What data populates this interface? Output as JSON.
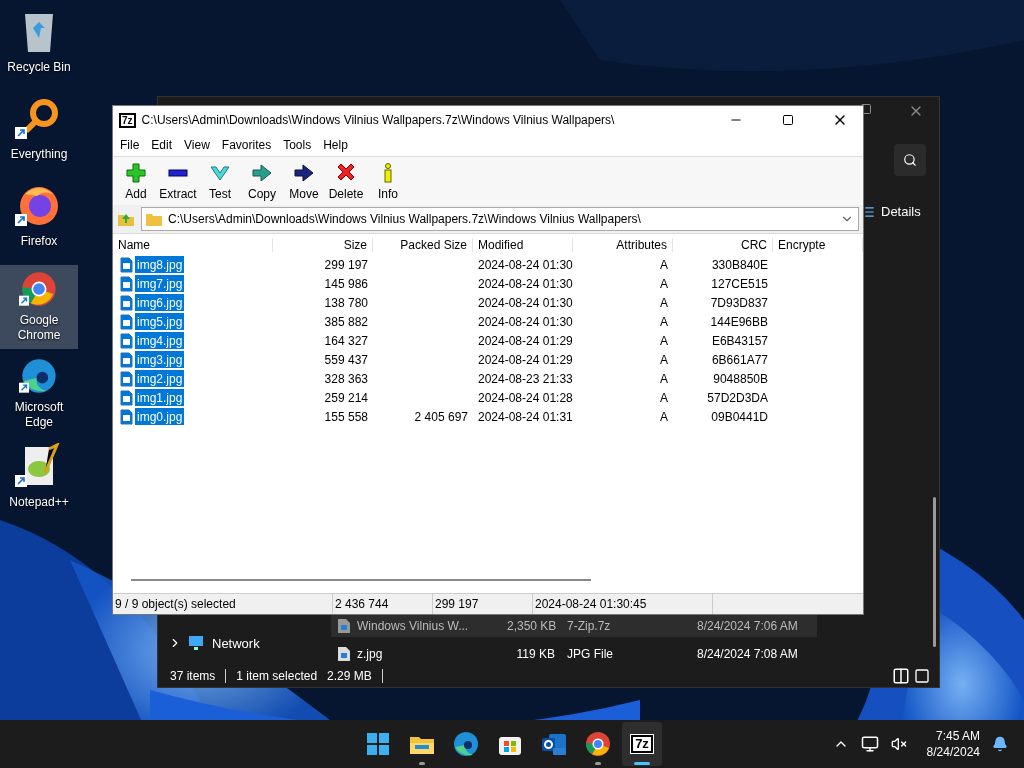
{
  "desktop_icons": [
    {
      "label": "Recycle Bin",
      "selected": false
    },
    {
      "label": "Everything",
      "selected": false
    },
    {
      "label": "Firefox",
      "selected": false
    },
    {
      "label": "Google Chrome",
      "selected": true
    },
    {
      "label": "Microsoft Edge",
      "selected": false
    },
    {
      "label": "Notepad++",
      "selected": false
    }
  ],
  "explorer": {
    "details": "Details",
    "nav": [
      {
        "label": "Network",
        "expanded": false
      }
    ],
    "files": [
      {
        "name": "Windows Vilnius W...",
        "size": "2,350 KB",
        "type": "7-Zip.7z",
        "date": "8/24/2024 7:06 AM",
        "selected": true
      },
      {
        "name": "z.jpg",
        "size": "119 KB",
        "type": "JPG File",
        "date": "8/24/2024 7:08 AM",
        "selected": false
      }
    ],
    "status": [
      "37 items",
      "1 item selected",
      "2.29 MB"
    ]
  },
  "window": {
    "logo": "7z",
    "title": "C:\\Users\\Admin\\Downloads\\Windows Vilnius Wallpapers.7z\\Windows Vilnius Wallpapers\\",
    "menu": [
      "File",
      "Edit",
      "View",
      "Favorites",
      "Tools",
      "Help"
    ],
    "toolbar": [
      "Add",
      "Extract",
      "Test",
      "Copy",
      "Move",
      "Delete",
      "Info"
    ],
    "address": "C:\\Users\\Admin\\Downloads\\Windows Vilnius Wallpapers.7z\\Windows Vilnius Wallpapers\\",
    "columns": [
      "Name",
      "Size",
      "Packed Size",
      "Modified",
      "Attributes",
      "CRC",
      "Encrypte"
    ],
    "rows": [
      {
        "name": "img8.jpg",
        "size": "299 197",
        "packed": "",
        "modified": "2024-08-24 01:30",
        "attributes": "A",
        "crc": "330B840E",
        "selected": true
      },
      {
        "name": "img7.jpg",
        "size": "145 986",
        "packed": "",
        "modified": "2024-08-24 01:30",
        "attributes": "A",
        "crc": "127CE515",
        "selected": true
      },
      {
        "name": "img6.jpg",
        "size": "138 780",
        "packed": "",
        "modified": "2024-08-24 01:30",
        "attributes": "A",
        "crc": "7D93D837",
        "selected": true
      },
      {
        "name": "img5.jpg",
        "size": "385 882",
        "packed": "",
        "modified": "2024-08-24 01:30",
        "attributes": "A",
        "crc": "144E96BB",
        "selected": true
      },
      {
        "name": "img4.jpg",
        "size": "164 327",
        "packed": "",
        "modified": "2024-08-24 01:29",
        "attributes": "A",
        "crc": "E6B43157",
        "selected": true
      },
      {
        "name": "img3.jpg",
        "size": "559 437",
        "packed": "",
        "modified": "2024-08-24 01:29",
        "attributes": "A",
        "crc": "6B661A77",
        "selected": true
      },
      {
        "name": "img2.jpg",
        "size": "328 363",
        "packed": "",
        "modified": "2024-08-23 21:33",
        "attributes": "A",
        "crc": "9048850B",
        "selected": true
      },
      {
        "name": "img1.jpg",
        "size": "259 214",
        "packed": "",
        "modified": "2024-08-24 01:28",
        "attributes": "A",
        "crc": "57D2D3DA",
        "selected": true
      },
      {
        "name": "img0.jpg",
        "size": "155 558",
        "packed": "2 405 697",
        "modified": "2024-08-24 01:31",
        "attributes": "A",
        "crc": "09B0441D",
        "selected": true
      }
    ],
    "status": [
      "9 / 9 object(s) selected",
      "2 436 744",
      "299 197",
      "2024-08-24 01:30:45"
    ]
  },
  "taskbar": {
    "apps": [
      {
        "running": false,
        "active": false
      },
      {
        "running": true,
        "active": false
      },
      {
        "running": false,
        "active": false
      },
      {
        "running": false,
        "active": false
      },
      {
        "running": false,
        "active": false
      },
      {
        "running": true,
        "active": false
      },
      {
        "logo": "7z",
        "running": true,
        "active": true
      }
    ],
    "time": "7:45 AM",
    "date": "8/24/2024"
  }
}
